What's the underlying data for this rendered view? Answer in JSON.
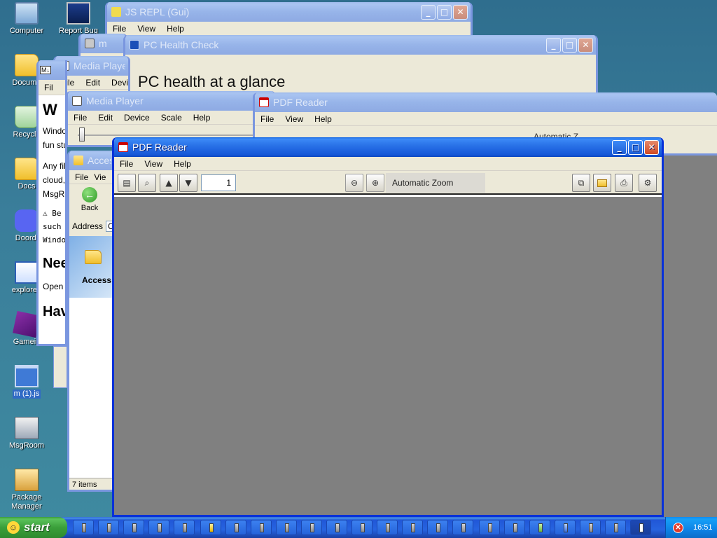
{
  "desktop": {
    "icons": [
      {
        "label": "Computer"
      },
      {
        "label": "Docume"
      },
      {
        "label": "Recycle"
      },
      {
        "label": "Docs"
      },
      {
        "label": "Doordi"
      },
      {
        "label": "explorer."
      },
      {
        "label": "Gamein"
      },
      {
        "label": "m (1).js"
      },
      {
        "label": "MsgRoom"
      },
      {
        "label": "Package Manager"
      },
      {
        "label": "Report Bug"
      }
    ]
  },
  "windows": {
    "js_repl": {
      "title": "JS REPL (Gui)",
      "menu": [
        "File",
        "View",
        "Help"
      ]
    },
    "m_window": {
      "title": "m"
    },
    "pc_health": {
      "title": "PC Health Check",
      "heading": "PC health at a glance"
    },
    "media_player_back": {
      "title": "Media Playe",
      "menu": [
        "File",
        "Edit",
        "Devi"
      ]
    },
    "readme": {
      "badge": "M↓",
      "menu_item": "Fil",
      "heading1": "W",
      "p1a": "Windo",
      "p1b": "fun stu",
      "p2a": "Any fil",
      "p2b": "cloud,",
      "p2c": "MsgRo",
      "warn1": "⚠ Be",
      "warn2": "such",
      "warn3": "Windo",
      "heading2": "Nee",
      "p3": "Open t",
      "heading3": "Hav"
    },
    "media_player_front": {
      "title": "Media Player",
      "menu": [
        "File",
        "Edit",
        "Device",
        "Scale",
        "Help"
      ]
    },
    "accessories": {
      "title": "Access",
      "menu": [
        "File",
        "Vie"
      ],
      "back_label": "Back",
      "address_label": "Address",
      "address_value": "C",
      "folder_label": "Access",
      "status": "7 items"
    },
    "pdf_back": {
      "title": "PDF Reader",
      "menu": [
        "File",
        "View",
        "Help"
      ],
      "zoom": "Automatic Z"
    },
    "pdf_front": {
      "title": "PDF Reader",
      "menu": [
        "File",
        "View",
        "Help"
      ],
      "page_number": "1",
      "zoom": "Automatic Zoom"
    }
  },
  "taskbar": {
    "start_label": "start",
    "clock": "16:51",
    "tasks": [
      {
        "icon": "app-icon"
      },
      {
        "icon": "app-icon"
      },
      {
        "icon": "app-icon"
      },
      {
        "icon": "app-icon"
      },
      {
        "icon": "app-icon"
      },
      {
        "icon": "js-icon"
      },
      {
        "icon": "app-icon"
      },
      {
        "icon": "app-icon"
      },
      {
        "icon": "app-icon"
      },
      {
        "icon": "app-icon"
      },
      {
        "icon": "app-icon"
      },
      {
        "icon": "app-icon"
      },
      {
        "icon": "app-icon"
      },
      {
        "icon": "app-icon"
      },
      {
        "icon": "app-icon"
      },
      {
        "icon": "app-icon"
      },
      {
        "icon": "app-icon"
      },
      {
        "icon": "app-icon"
      },
      {
        "icon": "app-icon"
      },
      {
        "icon": "app-icon"
      },
      {
        "icon": "app-icon"
      },
      {
        "icon": "app-icon"
      },
      {
        "icon": "pdf-icon"
      }
    ]
  },
  "colors": {
    "title_active": "#0831d9",
    "title_inactive": "#7a96df",
    "pdf_canvas": "#808080",
    "taskbar": "#2663e0",
    "start": "#3a9f3a"
  }
}
